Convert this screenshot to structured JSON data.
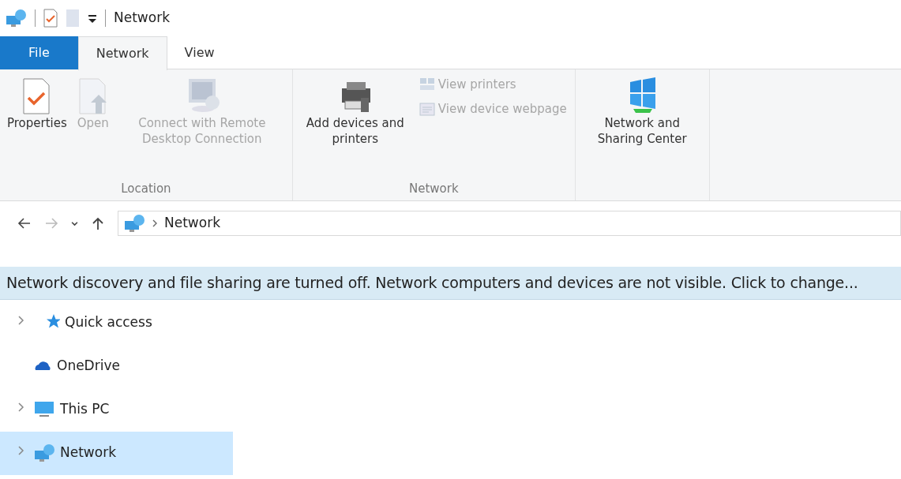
{
  "window": {
    "title": "Network"
  },
  "tabs": [
    {
      "label": "File",
      "kind": "file",
      "selected": false
    },
    {
      "label": "Network",
      "kind": "tab",
      "selected": true
    },
    {
      "label": "View",
      "kind": "tab",
      "selected": false
    }
  ],
  "ribbon": {
    "groups": [
      {
        "label": "Location",
        "buttons": [
          {
            "label": "Properties",
            "kind": "large",
            "disabled": false
          },
          {
            "label": "Open",
            "kind": "large",
            "disabled": true
          },
          {
            "label": "Connect with Remote Desktop Connection",
            "kind": "large",
            "disabled": true
          }
        ]
      },
      {
        "label": "Network",
        "buttons": [
          {
            "label": "Add devices and printers",
            "kind": "large",
            "disabled": false
          },
          {
            "label": "View printers",
            "kind": "small",
            "disabled": true
          },
          {
            "label": "View device webpage",
            "kind": "small",
            "disabled": true
          }
        ]
      },
      {
        "buttons": [
          {
            "label": "Network and Sharing Center",
            "kind": "large",
            "disabled": false
          }
        ]
      }
    ]
  },
  "navigation": {
    "buttons": [
      {
        "kind": "back",
        "disabled": false
      },
      {
        "kind": "forward",
        "disabled": true
      },
      {
        "kind": "recent",
        "disabled": false
      },
      {
        "kind": "up",
        "disabled": false
      }
    ],
    "address": {
      "path": [
        "Network"
      ]
    }
  },
  "info_bar": {
    "text": "Network discovery and file sharing are turned off. Network computers and devices are not visible. Click to change..."
  },
  "nav_pane": {
    "items": [
      {
        "label": "Quick access",
        "expandable": true,
        "selected": false
      },
      {
        "label": "OneDrive",
        "expandable": false,
        "selected": false
      },
      {
        "label": "This PC",
        "expandable": true,
        "selected": false
      },
      {
        "label": "Network",
        "expandable": true,
        "selected": true
      }
    ]
  }
}
